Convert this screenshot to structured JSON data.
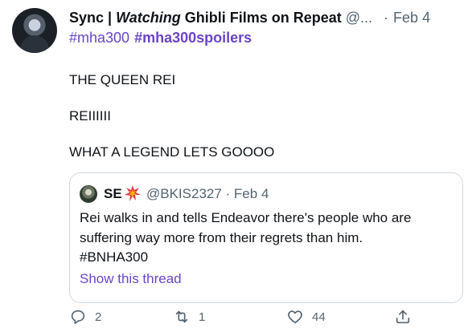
{
  "tweet": {
    "display_name_prefix": "Sync | ",
    "display_name_italic": "Watching",
    "display_name_suffix": " Ghibli Films on Repeat",
    "handle": "@...",
    "dot": "·",
    "date": "Feb 4",
    "hashtag_1": "#mha300",
    "hashtag_2": "#mha300spoilers",
    "lines": [
      "THE QUEEN REI",
      "REIIIIII",
      "WHAT A LEGEND LETS GOOOO"
    ]
  },
  "quote": {
    "name": "SE",
    "emoji": "collision-emoji",
    "handle": "@BKIS2327 · Feb 4",
    "lines": [
      "Rei walks in and tells Endeavor there's people who are",
      "suffering way more from their regrets than him.",
      "#BNHA300"
    ],
    "show_thread": "Show this thread"
  },
  "actions": {
    "reply_count": "2",
    "retweet_count": "1",
    "like_count": "44"
  },
  "colors": {
    "accent": "#6a44c9",
    "muted": "#536471",
    "border": "#cfd9de"
  }
}
